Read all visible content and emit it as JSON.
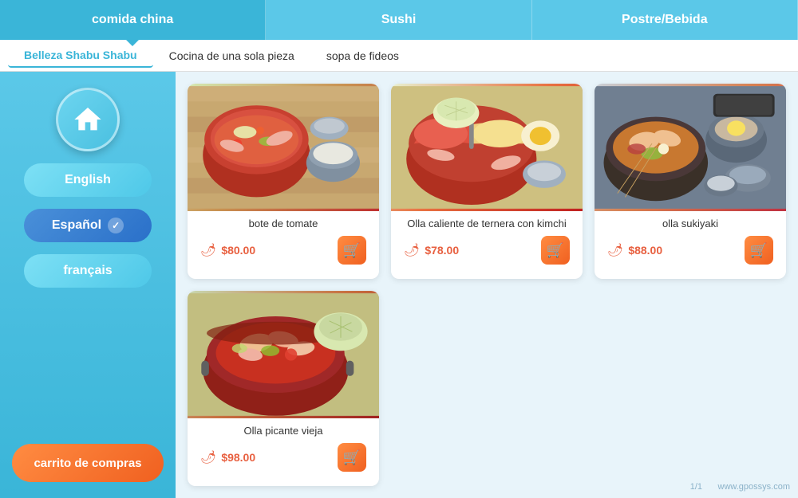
{
  "topTabs": [
    {
      "label": "comida china",
      "active": true
    },
    {
      "label": "Sushi",
      "active": false
    },
    {
      "label": "Postre/Bebida",
      "active": false
    }
  ],
  "subTabs": [
    {
      "label": "Belleza Shabu Shabu",
      "active": true
    },
    {
      "label": "Cocina de una sola pieza",
      "active": false
    },
    {
      "label": "sopa de fideos",
      "active": false
    }
  ],
  "sidebar": {
    "homeLabel": "home",
    "languages": [
      {
        "label": "English",
        "active": false
      },
      {
        "label": "Español",
        "active": true
      },
      {
        "label": "français",
        "active": false
      }
    ],
    "cartLabel": "carrito de compras"
  },
  "foods": [
    {
      "name": "bote de tomate",
      "price": "$80.00",
      "imageType": "tomato"
    },
    {
      "name": "Olla caliente de ternera con kimchi",
      "price": "$78.00",
      "imageType": "kimchi"
    },
    {
      "name": "olla sukiyaki",
      "price": "$88.00",
      "imageType": "sukiyaki"
    },
    {
      "name": "Olla picante vieja",
      "price": "$98.00",
      "imageType": "spicy"
    }
  ],
  "watermark": "www.gpossys.com",
  "pageNum": "1/1"
}
